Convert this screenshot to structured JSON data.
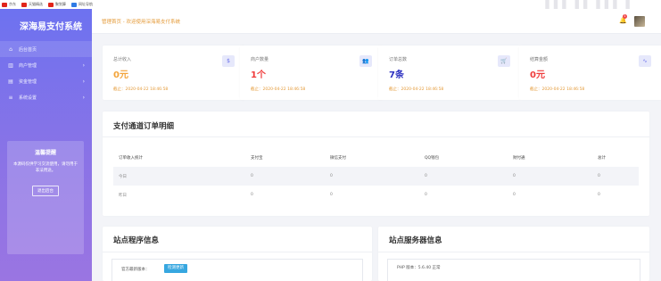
{
  "bookmarks": [
    {
      "label": "京东",
      "color": "#e1251b"
    },
    {
      "label": "天猫精选",
      "color": "#e1251b"
    },
    {
      "label": "聚划算",
      "color": "#e1251b"
    },
    {
      "label": "网址导航",
      "color": "#2f7be5"
    }
  ],
  "sidebar": {
    "brand": "深海易支付系统",
    "items": [
      {
        "label": "后台首页",
        "icon": "gauge-icon",
        "glyph": "⌂",
        "arrow": ""
      },
      {
        "label": "商户管理",
        "icon": "bars-icon",
        "glyph": "▥",
        "arrow": "›"
      },
      {
        "label": "资金管理",
        "icon": "ledger-icon",
        "glyph": "▤",
        "arrow": "›"
      },
      {
        "label": "系统设置",
        "icon": "list-icon",
        "glyph": "≡",
        "arrow": "›"
      }
    ],
    "notice": {
      "title": "温馨提醒",
      "body": "本源码仅供学习交流使用，请勿用于非法用途。",
      "button": "退出后台"
    }
  },
  "header": {
    "welcome": "管理首页 - 欢迎使用深海易支付系统",
    "notification_count": "1"
  },
  "stats": [
    {
      "title": "总计收入",
      "value": "0元",
      "value_color": "#f3a43a",
      "date": "截止：2020-04-22 18:46:58",
      "icon": "dollar-icon",
      "glyph": "$"
    },
    {
      "title": "商户数量",
      "value": "1个",
      "value_color": "#ef3b3b",
      "date": "截止：2020-04-22 18:46:58",
      "icon": "users-icon",
      "glyph": "👥"
    },
    {
      "title": "订单总数",
      "value": "7条",
      "value_color": "#2b2fc0",
      "date": "截止：2020-04-22 18:46:58",
      "icon": "cart-icon",
      "glyph": "🛒"
    },
    {
      "title": "结算金额",
      "value": "0元",
      "value_color": "#ef3b3b",
      "date": "截止：2020-04-22 18:46:58",
      "icon": "chart-icon",
      "glyph": "∿"
    }
  ],
  "orders_panel": {
    "title": "支付通道订单明细",
    "columns": [
      "订单收入统计",
      "支付宝",
      "微信支付",
      "QQ钱包",
      "财付通",
      "总计"
    ],
    "rows": [
      [
        "今日",
        "0",
        "0",
        "0",
        "0",
        "0"
      ],
      [
        "昨日",
        "0",
        "0",
        "0",
        "0",
        "0"
      ]
    ]
  },
  "program_panel": {
    "title": "站点程序信息",
    "label": "官方最新版本：",
    "button": "检测更新"
  },
  "server_panel": {
    "title": "站点服务器信息",
    "php_version": "PHP 版本：5.6.40 正常"
  }
}
